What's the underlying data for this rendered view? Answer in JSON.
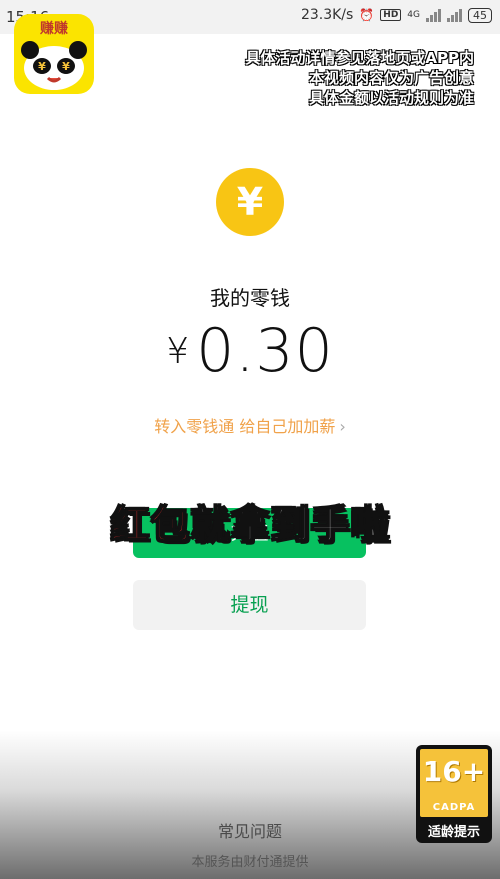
{
  "status_bar": {
    "time": "15:16",
    "network_speed": "23.3K/s",
    "alarm_icon": "alarm-clock-icon",
    "hd_label": "HD",
    "network_type": "4G",
    "battery": "45"
  },
  "app_logo": {
    "name": "赚赚",
    "icon": "panda-icon",
    "bg_color": "#fbe400"
  },
  "disclaimer": {
    "line1": "具体活动详情参见落地页或APP内",
    "line2": "本视频内容仅为广告创意",
    "line3": "具体金额以活动规则为准"
  },
  "wallet": {
    "coin_icon": "yuan-coin-icon",
    "coin_symbol": "¥",
    "title": "我的零钱",
    "currency": "¥",
    "balance": "0.30",
    "promo_text": "转入零钱通 给自己加加薪",
    "promo_chevron": "›"
  },
  "buttons": {
    "recharge_label": "充值",
    "withdraw_label": "提现"
  },
  "overlay_caption": {
    "red_part": "红包",
    "white_part": "就拿到手啦"
  },
  "footer": {
    "faq": "常见问题",
    "provider": "本服务由财付通提供"
  },
  "age_rating": {
    "age": "16+",
    "org": "CADPA",
    "label": "适龄提示"
  },
  "colors": {
    "accent_green": "#07c160",
    "coin_yellow": "#f8c514",
    "promo_orange": "#f0a24a"
  }
}
